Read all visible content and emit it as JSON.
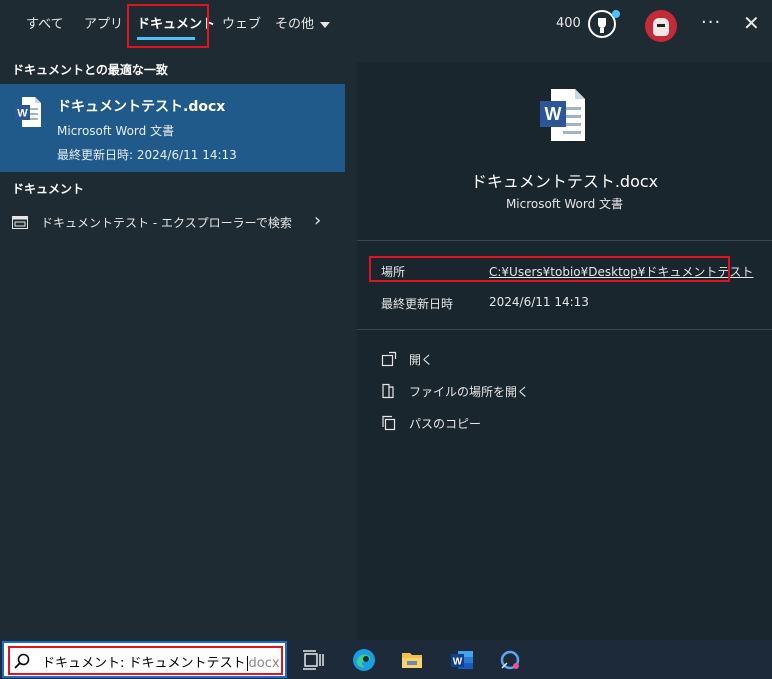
{
  "tabs": [
    {
      "label": "すべて"
    },
    {
      "label": "アプリ"
    },
    {
      "label": "ドキュメント"
    },
    {
      "label": "ウェブ"
    },
    {
      "label": "その他"
    }
  ],
  "header": {
    "points": "400"
  },
  "left": {
    "best_match_title": "ドキュメントとの最適な一致",
    "best_match": {
      "name": "ドキュメントテスト.docx",
      "type": "Microsoft Word 文書",
      "modified": "最終更新日時: 2024/6/11 14:13"
    },
    "documents_title": "ドキュメント",
    "doc_row": "ドキュメントテスト - エクスプローラーで検索"
  },
  "right": {
    "name": "ドキュメントテスト.docx",
    "type": "Microsoft Word 文書",
    "location_label": "場所",
    "location_value": "C:¥Users¥tobio¥Desktop¥ドキュメントテスト",
    "modified_label": "最終更新日時",
    "modified_value": "2024/6/11 14:13",
    "actions": [
      {
        "label": "開く"
      },
      {
        "label": "ファイルの場所を開く"
      },
      {
        "label": "パスのコピー"
      }
    ]
  },
  "search": {
    "prefix": "ドキュメント: ドキュメントテスト",
    "suffix": "docx"
  },
  "colors": {
    "highlight_box": "#e0141e",
    "selection": "#1f5a8a",
    "accent": "#4cc2ff"
  }
}
